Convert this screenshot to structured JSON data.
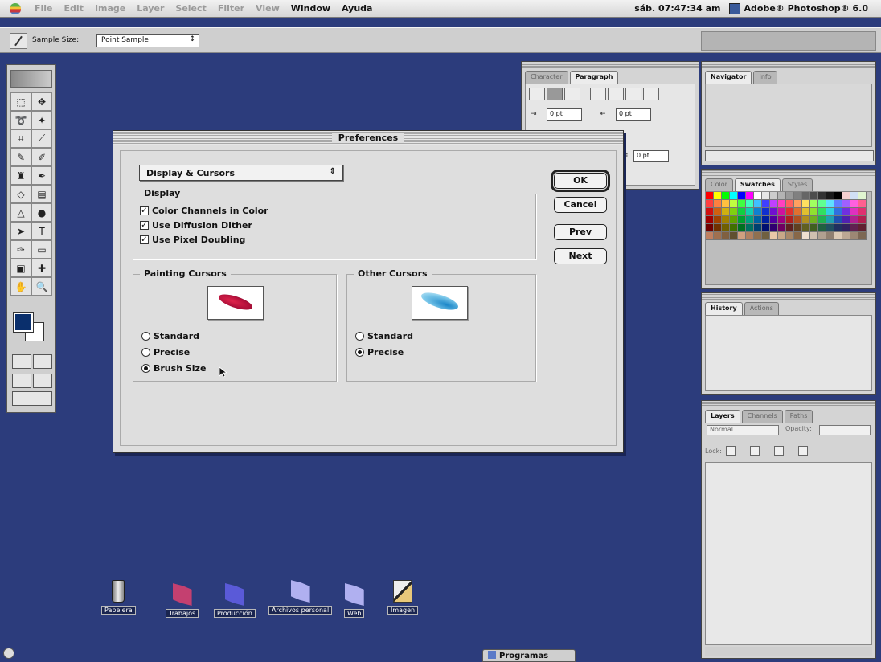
{
  "menubar": {
    "items": [
      "File",
      "Edit",
      "Image",
      "Layer",
      "Select",
      "Filter",
      "View",
      "Window",
      "Ayuda"
    ],
    "enabled": [
      false,
      false,
      false,
      false,
      false,
      false,
      false,
      true,
      true
    ],
    "clock": "sáb. 07:47:34 am",
    "app_name": "Adobe® Photoshop® 6.0"
  },
  "options_bar": {
    "sample_size_label": "Sample Size:",
    "sample_size_value": "Point Sample"
  },
  "palettes": {
    "paragraph": {
      "tabs": [
        "Character",
        "Paragraph"
      ],
      "active": 1,
      "fields": [
        "0 pt",
        "0 pt",
        "0 pt"
      ]
    },
    "navigator": {
      "tabs": [
        "Navigator",
        "Info"
      ],
      "active": 0
    },
    "swatches": {
      "tabs": [
        "Color",
        "Swatches",
        "Styles"
      ],
      "active": 1
    },
    "history": {
      "tabs": [
        "History",
        "Actions"
      ],
      "active": 0
    },
    "layers": {
      "tabs": [
        "Layers",
        "Channels",
        "Paths"
      ],
      "active": 0,
      "blend_mode": "Normal",
      "opacity_label": "Opacity:",
      "lock_label": "Lock:"
    }
  },
  "dialog": {
    "title": "Preferences",
    "section_popup": "Display & Cursors",
    "display_group": {
      "label": "Display",
      "options": [
        {
          "label": "Color Channels in Color",
          "checked": true
        },
        {
          "label": "Use Diffusion Dither",
          "checked": true
        },
        {
          "label": "Use Pixel Doubling",
          "checked": true
        }
      ]
    },
    "painting_cursors": {
      "label": "Painting Cursors",
      "options": [
        "Standard",
        "Precise",
        "Brush Size"
      ],
      "selected": "Brush Size"
    },
    "other_cursors": {
      "label": "Other Cursors",
      "options": [
        "Standard",
        "Precise"
      ],
      "selected": "Precise"
    },
    "buttons": {
      "ok": "OK",
      "cancel": "Cancel",
      "prev": "Prev",
      "next": "Next"
    }
  },
  "desktop": {
    "icons": [
      {
        "label": "Papelera",
        "kind": "trash"
      },
      {
        "label": "Trabajos",
        "kind": "folder"
      },
      {
        "label": "Producción",
        "kind": "folder-blue"
      },
      {
        "label": "Archivos personal",
        "kind": "folder-light"
      },
      {
        "label": "Web",
        "kind": "folder-light"
      },
      {
        "label": "Imagen",
        "kind": "app"
      }
    ],
    "taskbar_tab": "Programas"
  },
  "colors": {
    "desktop": "#2c3c7c",
    "dialog": "#dedede",
    "foreground_swatch": "#0a2f6c"
  }
}
